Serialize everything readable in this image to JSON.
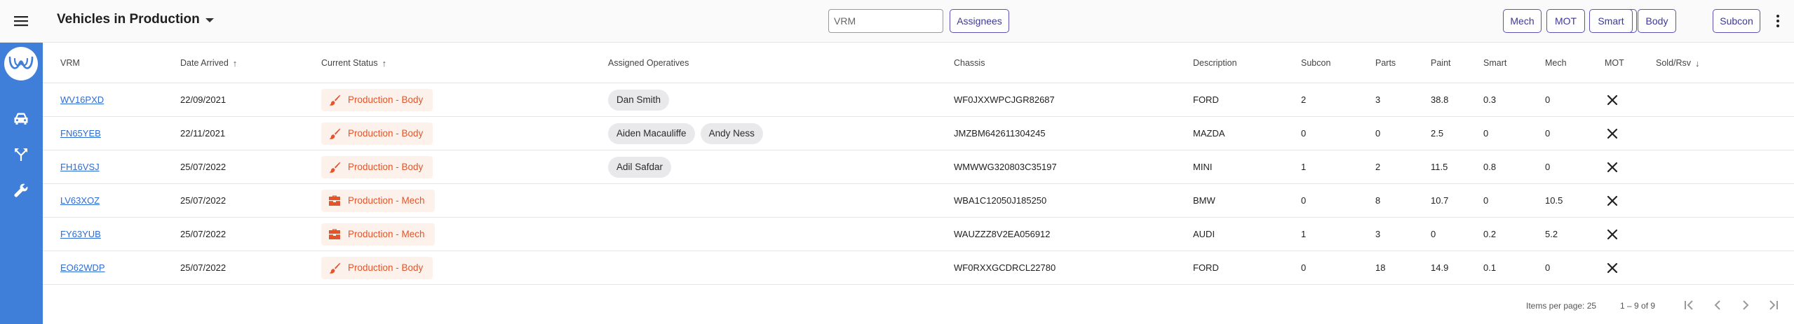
{
  "header": {
    "title": "Vehicles in Production",
    "vrm_placeholder": "VRM",
    "assignees_label": "Assignees",
    "filters": [
      "Mech",
      "MOT",
      "Smart",
      "Body",
      "Subcon"
    ]
  },
  "sidebar": {
    "logo_icon": "wb-logo-icon",
    "items": [
      "car-icon",
      "fork-icon",
      "wrench-icon"
    ]
  },
  "table": {
    "columns": {
      "vrm": "VRM",
      "date": "Date Arrived",
      "status": "Current Status",
      "operatives": "Assigned Operatives",
      "chassis": "Chassis",
      "description": "Description",
      "subcon": "Subcon",
      "parts": "Parts",
      "paint": "Paint",
      "smart": "Smart",
      "mech": "Mech",
      "mot": "MOT",
      "sold": "Sold/Rsv"
    },
    "rows": [
      {
        "vrm": "WV16PXD",
        "date": "22/09/2021",
        "status": "Production - Body",
        "status_icon": "brush-icon",
        "operatives": [
          "Dan Smith"
        ],
        "chassis": "WF0JXXWPCJGR82687",
        "description": "FORD",
        "subcon": "2",
        "parts": "3",
        "paint": "38.8",
        "smart": "0.3",
        "mech": "0"
      },
      {
        "vrm": "FN65YEB",
        "date": "22/11/2021",
        "status": "Production - Body",
        "status_icon": "brush-icon",
        "operatives": [
          "Aiden Macauliffe",
          "Andy Ness"
        ],
        "chassis": "JMZBM642611304245",
        "description": "MAZDA",
        "subcon": "0",
        "parts": "0",
        "paint": "2.5",
        "smart": "0",
        "mech": "0"
      },
      {
        "vrm": "FH16VSJ",
        "date": "25/07/2022",
        "status": "Production - Body",
        "status_icon": "brush-icon",
        "operatives": [
          "Adil Safdar"
        ],
        "chassis": "WMWWG320803C35197",
        "description": "MINI",
        "subcon": "1",
        "parts": "2",
        "paint": "11.5",
        "smart": "0.8",
        "mech": "0"
      },
      {
        "vrm": "LV63XOZ",
        "date": "25/07/2022",
        "status": "Production - Mech",
        "status_icon": "toolbox-icon",
        "operatives": [],
        "chassis": "WBA1C12050J185250",
        "description": "BMW",
        "subcon": "0",
        "parts": "8",
        "paint": "10.7",
        "smart": "0",
        "mech": "10.5"
      },
      {
        "vrm": "FY63YUB",
        "date": "25/07/2022",
        "status": "Production - Mech",
        "status_icon": "toolbox-icon",
        "operatives": [],
        "chassis": "WAUZZZ8V2EA056912",
        "description": "AUDI",
        "subcon": "1",
        "parts": "3",
        "paint": "0",
        "smart": "0.2",
        "mech": "5.2"
      },
      {
        "vrm": "EO62WDP",
        "date": "25/07/2022",
        "status": "Production - Body",
        "status_icon": "brush-icon",
        "operatives": [],
        "chassis": "WF0RXXGCDRCL22780",
        "description": "FORD",
        "subcon": "0",
        "parts": "18",
        "paint": "14.9",
        "smart": "0.1",
        "mech": "0"
      }
    ]
  },
  "paginator": {
    "items_per_page_label": "Items per page:",
    "items_per_page": "25",
    "range": "1 – 9 of 9"
  },
  "colors": {
    "sidebar": "#3f7fd9",
    "accent": "#5b52b4",
    "status_text": "#e2552a",
    "status_bg": "#fdf1ec",
    "link": "#2d6cd4"
  }
}
